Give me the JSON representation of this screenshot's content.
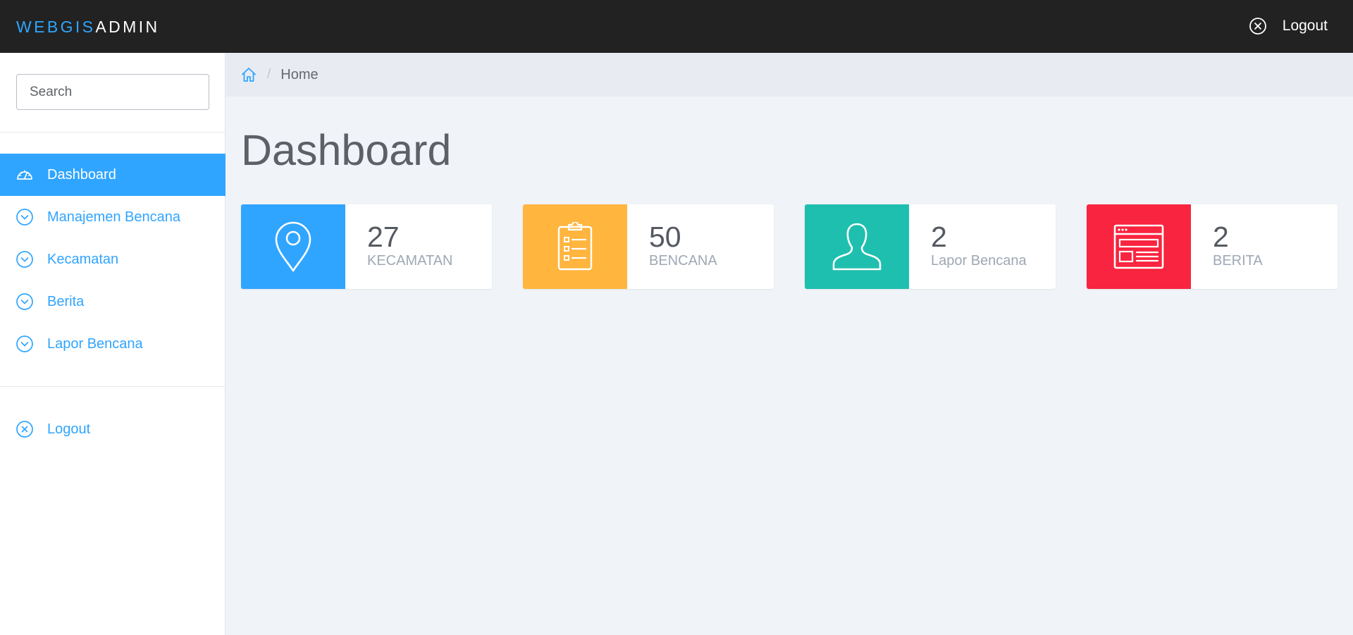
{
  "header": {
    "brand_part1": "WEBGIS",
    "brand_part2": "ADMIN",
    "logout_label": "Logout"
  },
  "sidebar": {
    "search_placeholder": "Search",
    "items": [
      {
        "label": "Dashboard",
        "icon": "dashboard-gauge-icon",
        "active": true
      },
      {
        "label": "Manajemen Bencana",
        "icon": "chevron-down-circle-icon"
      },
      {
        "label": "Kecamatan",
        "icon": "chevron-down-circle-icon"
      },
      {
        "label": "Berita",
        "icon": "chevron-down-circle-icon"
      },
      {
        "label": "Lapor Bencana",
        "icon": "chevron-down-circle-icon"
      }
    ],
    "logout_label": "Logout"
  },
  "breadcrumb": {
    "separator": "/",
    "current": "Home"
  },
  "main": {
    "title": "Dashboard",
    "cards": [
      {
        "value": "27",
        "label": "KECAMATAN",
        "color": "#30a5ff",
        "icon": "map-pin-icon"
      },
      {
        "value": "50",
        "label": "BENCANA",
        "color": "#ffb53e",
        "icon": "clipboard-list-icon"
      },
      {
        "value": "2",
        "label": "Lapor Bencana",
        "color": "#1ebfae",
        "icon": "user-icon"
      },
      {
        "value": "2",
        "label": "BERITA",
        "color": "#f9243f",
        "icon": "browser-window-icon"
      }
    ]
  },
  "colors": {
    "accent": "#30a5ff",
    "topbar": "#222222",
    "background": "#f0f3f7"
  }
}
